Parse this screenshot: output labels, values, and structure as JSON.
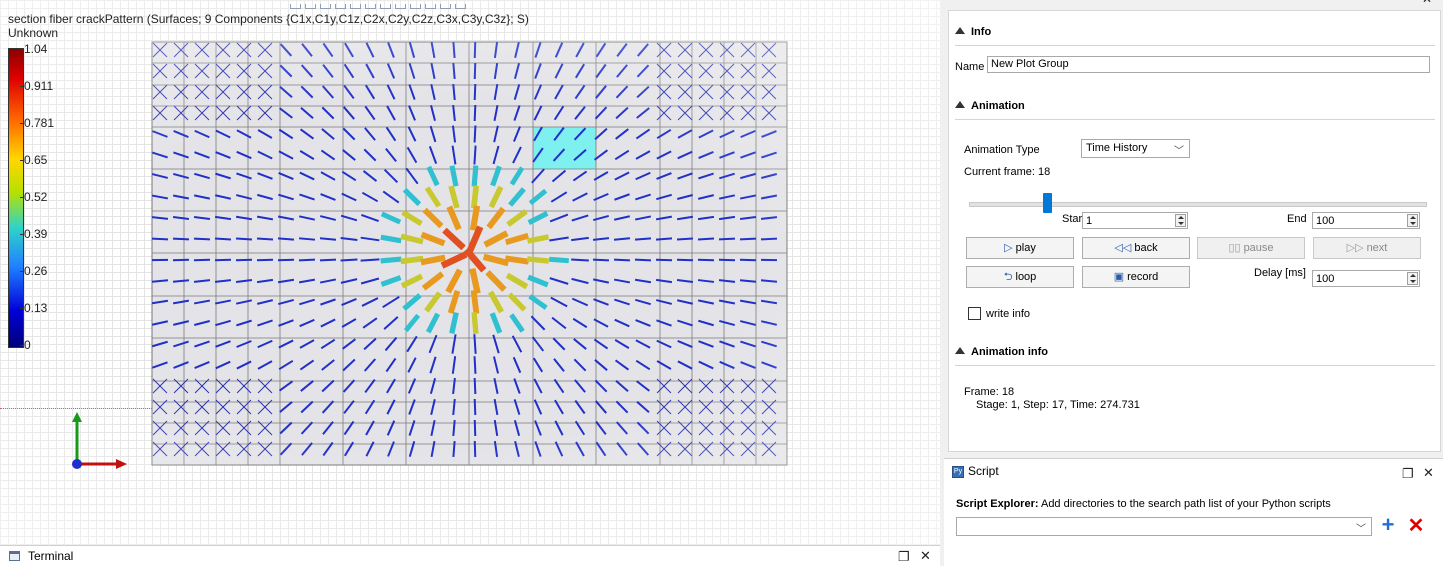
{
  "viewport": {
    "title": "section fiber crackPattern (Surfaces; 9 Components {C1x,C1y,C1z,C2x,C2y,C2z,C3x,C3y,C3z}; S)",
    "unit": "Unknown",
    "colorbar": {
      "ticks": [
        "1.04",
        "0.911",
        "0.781",
        "0.65",
        "0.52",
        "0.39",
        "0.26",
        "0.13",
        "0"
      ]
    }
  },
  "terminal": {
    "title": "Terminal"
  },
  "info": {
    "header": "Info",
    "name_label": "Name",
    "name_value": "New Plot Group"
  },
  "animation": {
    "header": "Animation",
    "type_label": "Animation Type",
    "type_value": "Time History",
    "current_frame_label": "Current frame: 18",
    "current_frame_fraction": 0.17,
    "start_label": "Start",
    "start_value": "1",
    "end_label": "End",
    "end_value": "100",
    "delay_label": "Delay [ms]",
    "delay_value": "100",
    "buttons": {
      "play": "play",
      "back": "back",
      "pause": "pause",
      "next": "next",
      "loop": "loop",
      "record": "record"
    },
    "write_info_label": "write info"
  },
  "animation_info": {
    "header": "Animation info",
    "frame_line": "Frame: 18",
    "stage_line": "Stage: 1, Step: 17, Time: 274.731"
  },
  "script": {
    "title": "Script",
    "desc_bold": "Script Explorer:",
    "desc_rest": " Add directories to the search path list of your Python scripts",
    "path_value": ""
  }
}
